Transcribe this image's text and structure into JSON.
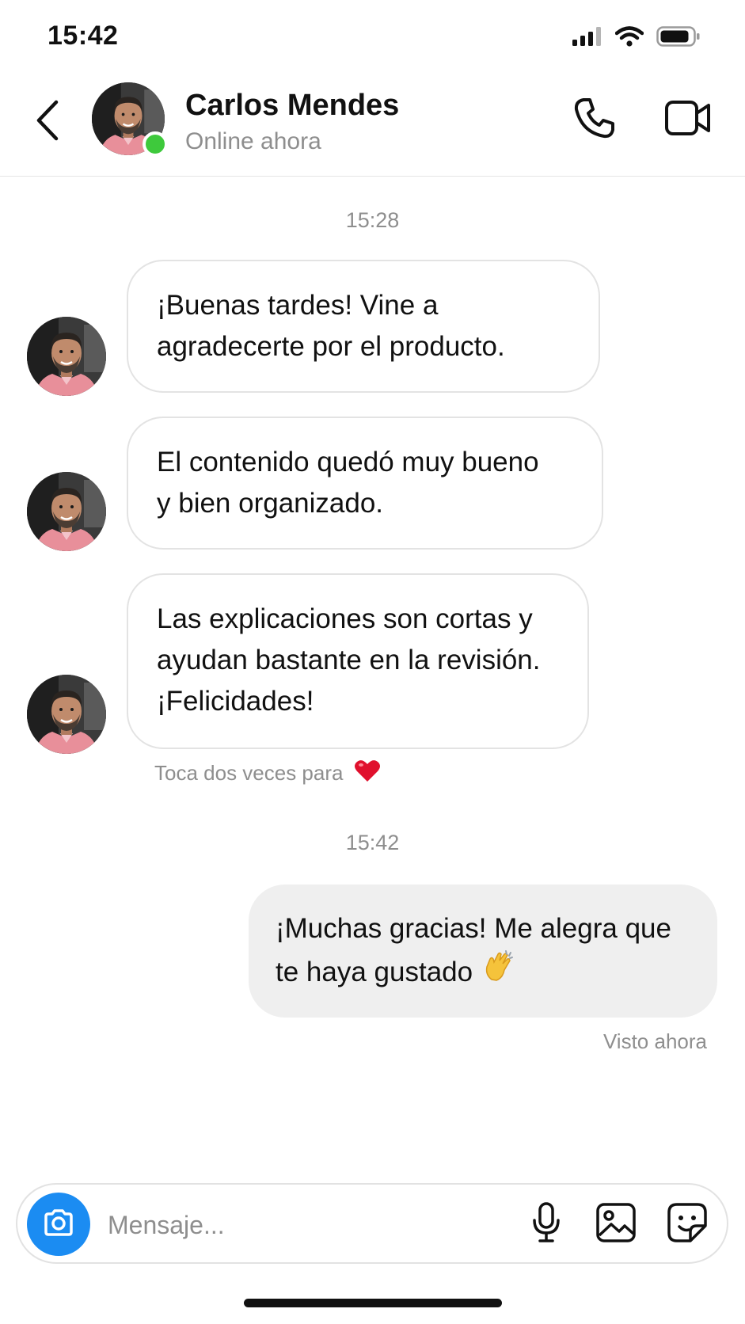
{
  "status_bar": {
    "time": "15:42"
  },
  "header": {
    "contact_name": "Carlos Mendes",
    "contact_status": "Online ahora"
  },
  "chat": {
    "timestamp_1": "15:28",
    "incoming": [
      {
        "line1": "¡Buenas tardes! Vine a",
        "line2": "agradecerte por el producto."
      },
      {
        "line1": "El contenido quedó muy bueno",
        "line2": "y bien organizado."
      },
      {
        "line1": "Las explicaciones son cortas y",
        "line2": "ayudan bastante en la revisión.",
        "line3": "¡Felicidades!"
      }
    ],
    "like_hint": "Toca dos veces para",
    "like_emoji": "❤️",
    "timestamp_2": "15:42",
    "outgoing": {
      "line1": "¡Muchas gracias! Me alegra que",
      "line2": "te haya gustado",
      "emoji": "👏"
    },
    "seen_label": "Visto ahora"
  },
  "composer": {
    "placeholder": "Mensaje..."
  },
  "icons": {
    "back": "chevron-left-icon",
    "call": "phone-icon",
    "video": "video-camera-icon",
    "camera": "camera-icon",
    "mic": "microphone-icon",
    "gallery": "image-icon",
    "sticker": "sticker-icon"
  },
  "colors": {
    "accent_blue": "#1b8cf2",
    "online_green": "#3ec93c",
    "outgoing_bubble": "#efefef",
    "like_heart": "#e0102d"
  }
}
